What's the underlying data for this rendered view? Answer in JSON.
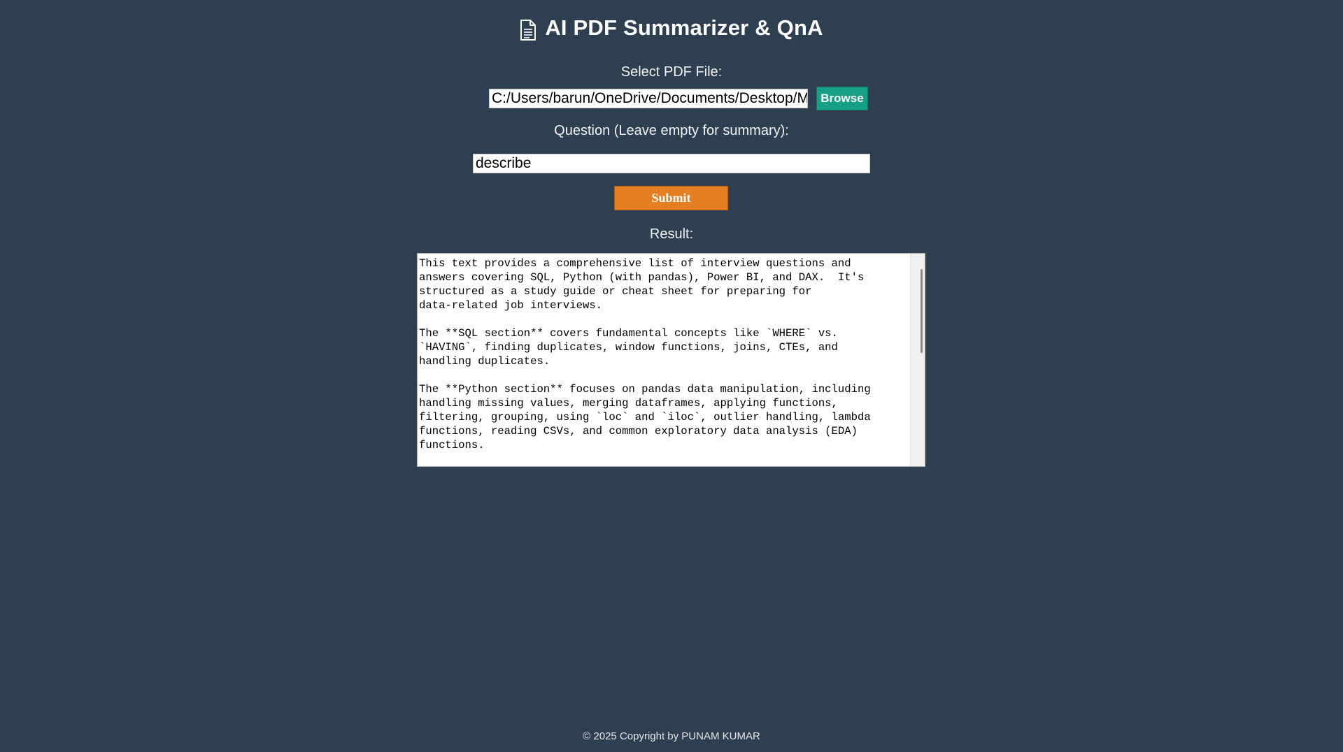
{
  "app": {
    "icon": "document-icon",
    "title": "AI PDF Summarizer & QnA"
  },
  "file_section": {
    "label": "Select PDF File:",
    "path_value": "C:/Users/barun/OneDrive/Documents/Desktop/Mock",
    "browse_label": "Browse"
  },
  "question_section": {
    "label": "Question (Leave empty for summary):",
    "value": "describe"
  },
  "submit_label": "Submit",
  "result_section": {
    "label": "Result:",
    "text": "This text provides a comprehensive list of interview questions and\nanswers covering SQL, Python (with pandas), Power BI, and DAX.  It's\nstructured as a study guide or cheat sheet for preparing for\ndata-related job interviews.\n\nThe **SQL section** covers fundamental concepts like `WHERE` vs.\n`HAVING`, finding duplicates, window functions, joins, CTEs, and\nhandling duplicates.\n\nThe **Python section** focuses on pandas data manipulation, including\nhandling missing values, merging dataframes, applying functions,\nfiltering, grouping, using `loc` and `iloc`, outlier handling, lambda\nfunctions, reading CSVs, and common exploratory data analysis (EDA)\nfunctions."
  },
  "footer": {
    "copyright": "© 2025 Copyright by PUNAM KUMAR"
  },
  "colors": {
    "background": "#2e3f51",
    "browse_button": "#16a085",
    "submit_button": "#e67e22"
  }
}
